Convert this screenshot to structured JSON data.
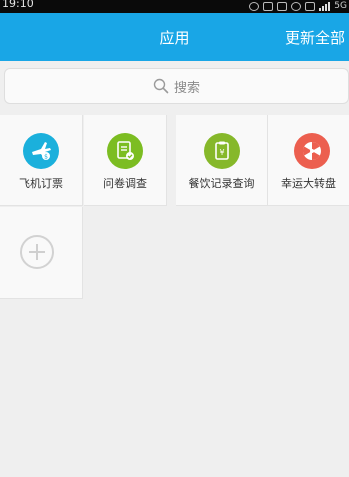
{
  "status_bar": {
    "time": "19:10",
    "network_label": "5G"
  },
  "header": {
    "title": "应用",
    "action_label": "更新全部"
  },
  "search": {
    "placeholder": "搜索"
  },
  "apps": [
    {
      "label": "飞机订票",
      "icon": "airplane-ticket-icon",
      "color": "#1bb0dc"
    },
    {
      "label": "问卷调查",
      "icon": "survey-icon",
      "color": "#7cbd22"
    },
    {
      "label": "餐饮记录查询",
      "icon": "dining-record-icon",
      "color": "#86b82a"
    },
    {
      "label": "幸运大转盘",
      "icon": "lucky-wheel-icon",
      "color": "#ec5f4f"
    }
  ],
  "colors": {
    "header": "#19a6e6",
    "background": "#efefef"
  }
}
